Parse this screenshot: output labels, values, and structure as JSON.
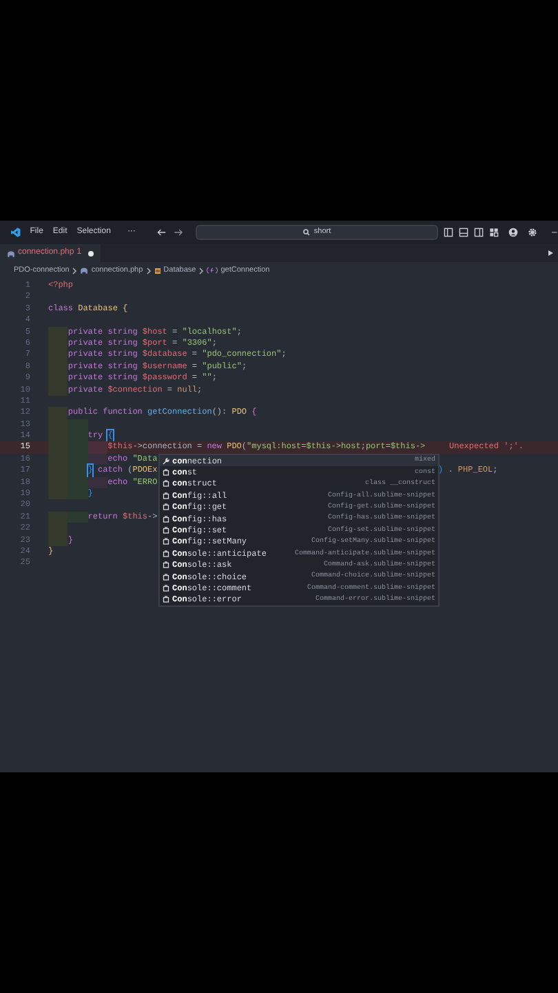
{
  "titlebar": {
    "menus": [
      "File",
      "Edit",
      "Selection"
    ],
    "more": "···",
    "search": "short"
  },
  "tab": {
    "label": "connection.php",
    "problems": "1",
    "modified": true
  },
  "breadcrumb": [
    {
      "label": "PDO-connection",
      "kind": "folder"
    },
    {
      "label": "connection.php",
      "kind": "file"
    },
    {
      "label": "Database",
      "kind": "class"
    },
    {
      "label": "getConnection",
      "kind": "method"
    }
  ],
  "lines": [
    {
      "n": "1",
      "current": false,
      "tokens": [
        {
          "kind": "tag",
          "text": "<?php"
        }
      ]
    },
    {
      "n": "2",
      "current": false
    },
    {
      "n": "3",
      "current": false,
      "tokens": [
        {
          "kind": "kw",
          "text": "class "
        },
        {
          "kind": "cls",
          "text": "Database "
        },
        {
          "kind": "br",
          "text": "{"
        }
      ]
    },
    {
      "n": "4",
      "current": false
    },
    {
      "n": "5",
      "current": false,
      "guides": [
        {
          "color": "#343a2b"
        }
      ],
      "tokens": [
        {
          "kind": "kw",
          "text": "private string "
        },
        {
          "kind": "var",
          "text": "$host"
        },
        {
          "kind": "p",
          "text": " = "
        },
        {
          "kind": "str",
          "text": "\"localhost\""
        },
        {
          "kind": "p",
          "text": ";"
        }
      ]
    },
    {
      "n": "6",
      "current": false,
      "guides": [
        {
          "color": "#343a2b"
        }
      ],
      "tokens": [
        {
          "kind": "kw",
          "text": "private string "
        },
        {
          "kind": "var",
          "text": "$port"
        },
        {
          "kind": "p",
          "text": " = "
        },
        {
          "kind": "str",
          "text": "\"3306\""
        },
        {
          "kind": "p",
          "text": ";"
        }
      ]
    },
    {
      "n": "7",
      "current": false,
      "guides": [
        {
          "color": "#343a2b"
        }
      ],
      "tokens": [
        {
          "kind": "kw",
          "text": "private string "
        },
        {
          "kind": "var",
          "text": "$database"
        },
        {
          "kind": "p",
          "text": " = "
        },
        {
          "kind": "str",
          "text": "\"pdo_connection\""
        },
        {
          "kind": "p",
          "text": ";"
        }
      ]
    },
    {
      "n": "8",
      "current": false,
      "guides": [
        {
          "color": "#343a2b"
        }
      ],
      "tokens": [
        {
          "kind": "kw",
          "text": "private string "
        },
        {
          "kind": "var",
          "text": "$username"
        },
        {
          "kind": "p",
          "text": " = "
        },
        {
          "kind": "str",
          "text": "\"public\""
        },
        {
          "kind": "p",
          "text": ";"
        }
      ]
    },
    {
      "n": "9",
      "current": false,
      "guides": [
        {
          "color": "#343a2b"
        }
      ],
      "tokens": [
        {
          "kind": "kw",
          "text": "private string "
        },
        {
          "kind": "var",
          "text": "$password"
        },
        {
          "kind": "p",
          "text": " = "
        },
        {
          "kind": "str",
          "text": "\"\""
        },
        {
          "kind": "p",
          "text": ";"
        }
      ]
    },
    {
      "n": "10",
      "current": false,
      "guides": [
        {
          "color": "#343a2b"
        }
      ],
      "tokens": [
        {
          "kind": "kw",
          "text": "private "
        },
        {
          "kind": "var",
          "text": "$connection"
        },
        {
          "kind": "p",
          "text": " = "
        },
        {
          "kind": "const",
          "text": "null"
        },
        {
          "kind": "p",
          "text": ";"
        }
      ]
    },
    {
      "n": "11",
      "current": false
    },
    {
      "n": "12",
      "current": false,
      "guides": [
        {
          "color": "#343a2b"
        }
      ],
      "tokens": [
        {
          "kind": "kw",
          "text": "public function "
        },
        {
          "kind": "fn",
          "text": "getConnection"
        },
        {
          "kind": "p",
          "text": "(): "
        },
        {
          "kind": "cls",
          "text": "PDO "
        },
        {
          "kind": "br1",
          "text": "{"
        }
      ]
    },
    {
      "n": "13",
      "current": false,
      "guides": [
        {
          "color": "#343a2b"
        },
        {
          "color": "#2c3b30"
        }
      ]
    },
    {
      "n": "14",
      "current": false,
      "guides": [
        {
          "color": "#343a2b"
        },
        {
          "color": "#2c3b30"
        }
      ],
      "tokens": [
        {
          "kind": "kw",
          "text": "try "
        },
        {
          "kind": "brm",
          "text": "{"
        }
      ]
    },
    {
      "n": "15",
      "current": true,
      "guides": [
        {
          "color": "#343a2b"
        },
        {
          "color": "#2c3b30"
        },
        {
          "color": "#4a2f3a"
        }
      ],
      "diagnostic": "Unexpected ';'.",
      "tokens": [
        {
          "kind": "var",
          "text": "$this"
        },
        {
          "kind": "p",
          "text": "->connection = "
        },
        {
          "kind": "kw",
          "text": "new "
        },
        {
          "kind": "cls",
          "text": "PDO"
        },
        {
          "kind": "p",
          "text": "("
        },
        {
          "kind": "str",
          "text": "\"mysql:host=$this->host;port=$this->"
        }
      ]
    },
    {
      "n": "16",
      "current": false,
      "guides": [
        {
          "color": "#343a2b"
        },
        {
          "color": "#2c3b30"
        },
        {
          "color": "#392e3e"
        }
      ],
      "tokens": [
        {
          "kind": "kw",
          "text": "echo "
        },
        {
          "kind": "str",
          "text": "\"Data"
        }
      ]
    },
    {
      "n": "17",
      "current": false,
      "guides": [
        {
          "color": "#343a2b"
        },
        {
          "color": "#2c3b30"
        }
      ],
      "tokens": [
        {
          "kind": "brm",
          "text": "}"
        },
        {
          "kind": "kw",
          "text": " catch "
        },
        {
          "kind": "p",
          "text": "("
        },
        {
          "kind": "cls",
          "text": "PDOEx"
        }
      ],
      "tail": [
        {
          "kind": "br2",
          "text": ")"
        },
        {
          "kind": "p",
          "text": " . "
        },
        {
          "kind": "const",
          "text": "PHP_EOL"
        },
        {
          "kind": "p",
          "text": ";"
        }
      ]
    },
    {
      "n": "18",
      "current": false,
      "guides": [
        {
          "color": "#343a2b"
        },
        {
          "color": "#2c3b30"
        },
        {
          "color": "#392e3e"
        }
      ],
      "tokens": [
        {
          "kind": "kw",
          "text": "echo "
        },
        {
          "kind": "str",
          "text": "\"ERRO"
        }
      ]
    },
    {
      "n": "19",
      "current": false,
      "guides": [
        {
          "color": "#343a2b"
        },
        {
          "color": "#2c3b30"
        }
      ],
      "tokens": [
        {
          "kind": "br2",
          "text": "}"
        }
      ]
    },
    {
      "n": "20",
      "current": false
    },
    {
      "n": "21",
      "current": false,
      "guides": [
        {
          "color": "#343a2b"
        },
        {
          "color": "#2c3b30"
        }
      ],
      "tokens": [
        {
          "kind": "kw",
          "text": "return "
        },
        {
          "kind": "var",
          "text": "$this"
        },
        {
          "kind": "p",
          "text": "->"
        }
      ]
    },
    {
      "n": "22",
      "current": false,
      "guides": [
        {
          "color": "#343a2b"
        }
      ]
    },
    {
      "n": "23",
      "current": false,
      "guides": [
        {
          "color": "#343a2b"
        }
      ],
      "tokens": [
        {
          "kind": "br1",
          "text": "}"
        }
      ]
    },
    {
      "n": "24",
      "current": false,
      "tokens": [
        {
          "kind": "br",
          "text": "}"
        }
      ]
    },
    {
      "n": "25",
      "current": false
    }
  ],
  "suggestions": [
    {
      "match": "con",
      "rest": "nection",
      "detail": "mixed",
      "kind": "property",
      "selected": true
    },
    {
      "match": "con",
      "rest": "st",
      "detail": "const",
      "kind": "snippet",
      "selected": false
    },
    {
      "match": "con",
      "rest": "struct",
      "detail": "class __construct",
      "kind": "snippet",
      "selected": false
    },
    {
      "match": "Con",
      "rest": "fig::all",
      "detail": "Config-all.sublime-snippet",
      "kind": "snippet",
      "selected": false
    },
    {
      "match": "Con",
      "rest": "fig::get",
      "detail": "Config-get.sublime-snippet",
      "kind": "snippet",
      "selected": false
    },
    {
      "match": "Con",
      "rest": "fig::has",
      "detail": "Config-has.sublime-snippet",
      "kind": "snippet",
      "selected": false
    },
    {
      "match": "Con",
      "rest": "fig::set",
      "detail": "Config-set.sublime-snippet",
      "kind": "snippet",
      "selected": false
    },
    {
      "match": "Con",
      "rest": "fig::setMany",
      "detail": "Config-setMany.sublime-snippet",
      "kind": "snippet",
      "selected": false
    },
    {
      "match": "Con",
      "rest": "sole::anticipate",
      "detail": "Command-anticipate.sublime-snippet",
      "kind": "snippet",
      "selected": false
    },
    {
      "match": "Con",
      "rest": "sole::ask",
      "detail": "Command-ask.sublime-snippet",
      "kind": "snippet",
      "selected": false
    },
    {
      "match": "Con",
      "rest": "sole::choice",
      "detail": "Command-choice.sublime-snippet",
      "kind": "snippet",
      "selected": false
    },
    {
      "match": "Con",
      "rest": "sole::comment",
      "detail": "Command-comment.sublime-snippet",
      "kind": "snippet",
      "selected": false
    },
    {
      "match": "Con",
      "rest": "sole::error",
      "detail": "Command-error.sublime-snippet",
      "kind": "snippet",
      "selected": false
    }
  ]
}
